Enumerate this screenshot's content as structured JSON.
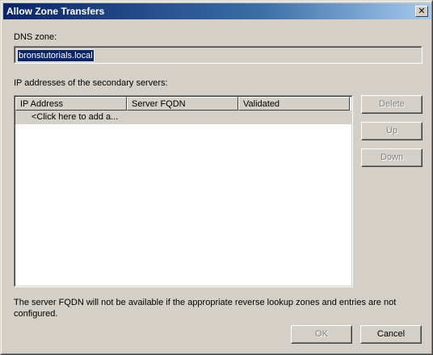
{
  "window": {
    "title": "Allow Zone Transfers",
    "close_glyph": "✕"
  },
  "dns_zone": {
    "label": "DNS zone:",
    "value": "bronstutorials.local"
  },
  "servers": {
    "label": "IP addresses of the secondary servers:",
    "columns": [
      "IP Address",
      "Server FQDN",
      "Validated"
    ],
    "add_row_text": "<Click here to add a..."
  },
  "side_buttons": {
    "delete": "Delete",
    "up": "Up",
    "down": "Down"
  },
  "note": "The server FQDN will not be available if the appropriate reverse lookup zones and entries are not configured.",
  "footer": {
    "ok": "OK",
    "cancel": "Cancel"
  }
}
